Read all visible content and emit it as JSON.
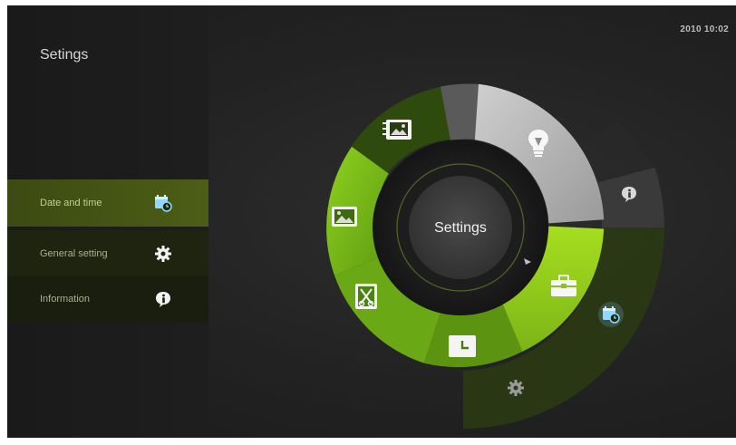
{
  "header": {
    "clock": "2010 10:02"
  },
  "sidebar": {
    "title": "Setings",
    "items": [
      {
        "label": "Date and time",
        "icon": "calendar-clock-icon",
        "selected": true
      },
      {
        "label": "General setting",
        "icon": "gear-icon",
        "selected": false
      },
      {
        "label": "Information",
        "icon": "info-bubble-icon",
        "selected": false
      }
    ]
  },
  "wheel": {
    "center_label": "Settings",
    "segments": [
      {
        "icon": "photo-album-icon",
        "state": "dark-green"
      },
      {
        "icon": "photo-icon",
        "state": "green"
      },
      {
        "icon": "cut-clip-icon",
        "state": "green"
      },
      {
        "icon": "clock-icon",
        "state": "green"
      },
      {
        "icon": "toolbox-icon",
        "state": "lime"
      },
      {
        "icon": "lightbulb-icon",
        "state": "grey-highlight"
      }
    ],
    "submenu": [
      {
        "icon": "info-bubble-icon"
      },
      {
        "icon": "calendar-clock-icon",
        "highlight": true
      },
      {
        "icon": "gear-icon"
      }
    ]
  },
  "colors": {
    "green": "#7bbf1a",
    "lime": "#9ed31b",
    "dark_green": "#2d3d0c",
    "grey_highlight": "#a9a9a9",
    "accent_blue": "#8fd8ff"
  }
}
